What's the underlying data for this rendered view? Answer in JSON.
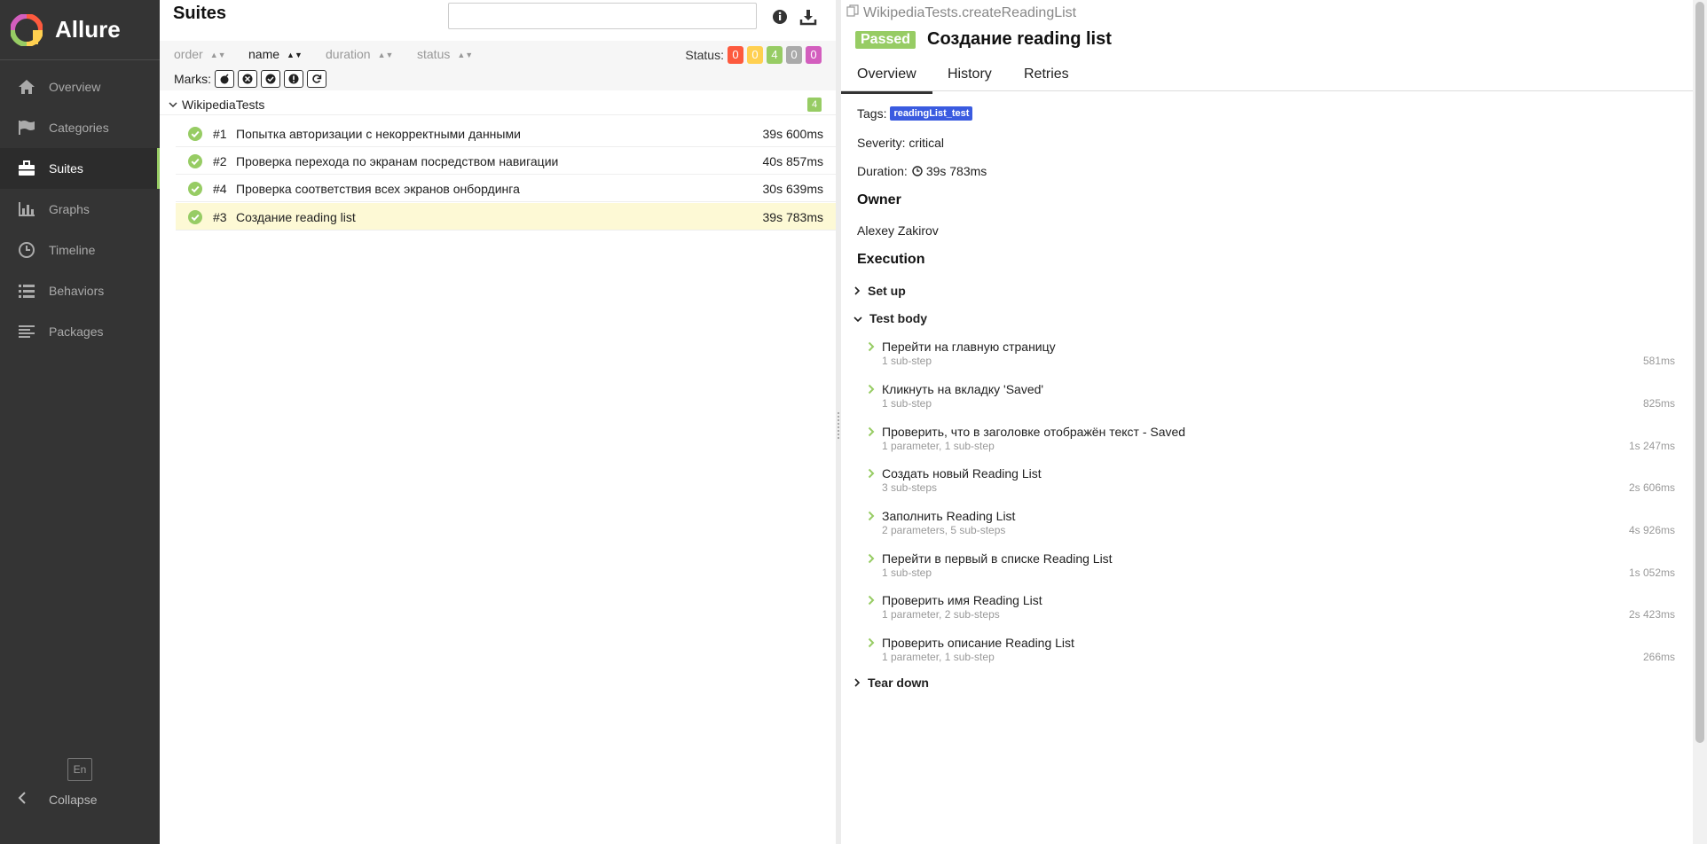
{
  "app": {
    "name": "Allure"
  },
  "sidebar": {
    "items": [
      {
        "label": "Overview",
        "icon": "home-icon"
      },
      {
        "label": "Categories",
        "icon": "flag-icon"
      },
      {
        "label": "Suites",
        "icon": "briefcase-icon",
        "active": true
      },
      {
        "label": "Graphs",
        "icon": "bar-chart-icon"
      },
      {
        "label": "Timeline",
        "icon": "clock-icon"
      },
      {
        "label": "Behaviors",
        "icon": "list-icon"
      },
      {
        "label": "Packages",
        "icon": "align-left-icon"
      }
    ],
    "language": "En",
    "collapse": "Collapse"
  },
  "suites": {
    "title": "Suites",
    "search_value": "",
    "sort": {
      "order": "order",
      "name": "name",
      "duration": "duration",
      "status": "status"
    },
    "status_label": "Status:",
    "status_counts": [
      {
        "value": "0",
        "color": "#fd5a3e"
      },
      {
        "value": "0",
        "color": "#ffd050"
      },
      {
        "value": "4",
        "color": "#97cc64"
      },
      {
        "value": "0",
        "color": "#aaaaaa"
      },
      {
        "value": "0",
        "color": "#d35ebe"
      }
    ],
    "marks_label": "Marks:",
    "group": {
      "name": "WikipediaTests",
      "count": "4"
    },
    "rows": [
      {
        "num": "#1",
        "name": "Попытка авторизации с некорректными данными",
        "duration": "39s 600ms"
      },
      {
        "num": "#2",
        "name": "Проверка перехода по экранам посредством навигации",
        "duration": "40s 857ms"
      },
      {
        "num": "#4",
        "name": "Проверка соответствия всех экранов онбординга",
        "duration": "30s 639ms"
      },
      {
        "num": "#3",
        "name": "Создание reading list",
        "duration": "39s 783ms",
        "selected": true
      }
    ]
  },
  "test": {
    "full_name": "WikipediaTests.createReadingList",
    "status": "Passed",
    "title": "Создание reading list",
    "tabs": [
      "Overview",
      "History",
      "Retries"
    ],
    "tags_label": "Tags:",
    "tag": "readingList_test",
    "severity": "Severity: critical",
    "duration_label": "Duration:",
    "duration": "39s 783ms",
    "owner_heading": "Owner",
    "owner": "Alexey Zakirov",
    "execution_heading": "Execution",
    "setup": "Set up",
    "body": "Test body",
    "teardown": "Tear down",
    "steps": [
      {
        "name": "Перейти на главную страницу",
        "sub": "1 sub-step",
        "duration": "581ms"
      },
      {
        "name": "Кликнуть на вкладку 'Saved'",
        "sub": "1 sub-step",
        "duration": "825ms"
      },
      {
        "name": "Проверить, что в заголовке отображён текст - Saved",
        "sub": "1 parameter, 1 sub-step",
        "duration": "1s 247ms"
      },
      {
        "name": "Создать новый Reading List",
        "sub": "3 sub-steps",
        "duration": "2s 606ms"
      },
      {
        "name": "Заполнить Reading List",
        "sub": "2 parameters, 5 sub-steps",
        "duration": "4s 926ms"
      },
      {
        "name": "Перейти в первый в списке Reading List",
        "sub": "1 sub-step",
        "duration": "1s 052ms"
      },
      {
        "name": "Проверить имя Reading List",
        "sub": "1 parameter, 2 sub-steps",
        "duration": "2s 423ms"
      },
      {
        "name": "Проверить описание Reading List",
        "sub": "1 parameter, 1 sub-step",
        "duration": "266ms"
      }
    ]
  },
  "colors": {
    "sidebar_bg": "#343434",
    "passed": "#97cc64",
    "tag": "#3a5be0",
    "selected_row": "#fdf9d5"
  }
}
